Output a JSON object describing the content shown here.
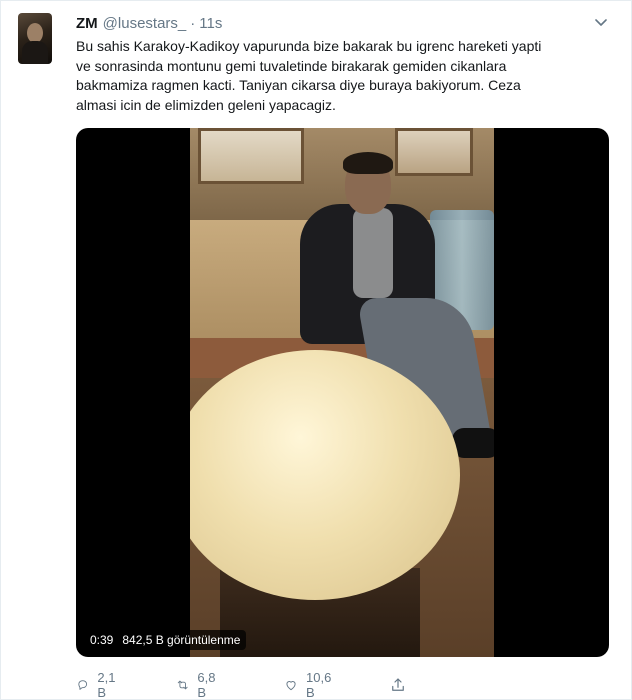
{
  "tweet": {
    "author_name": "ZM",
    "author_handle": "@lusestars_",
    "separator": "·",
    "time": "11s",
    "text_lines": [
      "Bu sahis Karakoy-Kadikoy vapurunda bize bakarak bu igrenc hareketi yapti",
      "ve sonrasinda montunu gemi tuvaletinde birakarak gemiden cikanlara",
      "bakmamiza ragmen kacti. Taniyan cikarsa diye buraya bakiyorum. Ceza",
      "almasi icin de elimizden geleni yapacagiz."
    ]
  },
  "video": {
    "duration": "0:39",
    "views": "842,5 B görüntülenme"
  },
  "actions": {
    "replies": "2,1 B",
    "retweets": "6,8 B",
    "likes": "10,6 B"
  },
  "icons": {
    "menu": "chevron-down-icon",
    "reply": "reply-icon",
    "retweet": "retweet-icon",
    "like": "heart-icon",
    "share": "share-icon"
  },
  "colors": {
    "text_primary": "#14171a",
    "text_secondary": "#657786",
    "border": "#e6ecf0"
  }
}
